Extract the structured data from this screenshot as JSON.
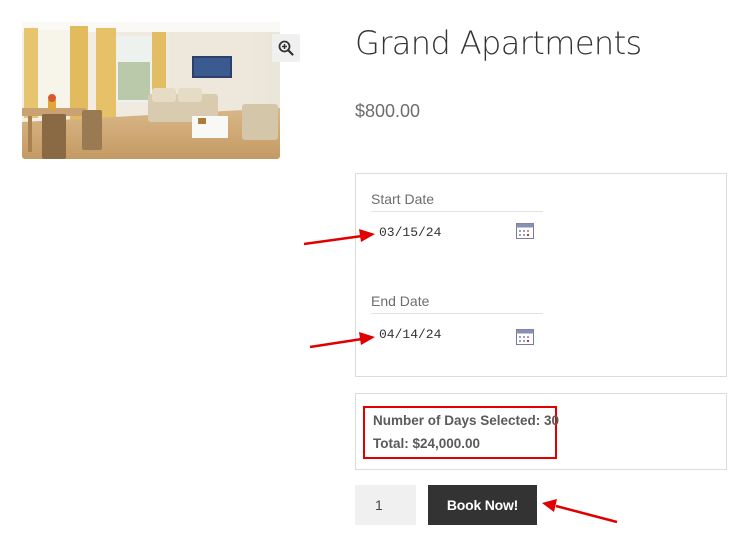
{
  "product": {
    "title": "Grand Apartments",
    "price": "$800.00",
    "image_alt": "apartment-interior-photo",
    "zoom_icon": "zoom-in-icon"
  },
  "booking": {
    "start_label": "Start Date",
    "start_value": "03/15/24",
    "end_label": "End Date",
    "end_value": "04/14/24",
    "calendar_icon": "calendar-icon"
  },
  "summary": {
    "days_text": "Number of Days Selected: 30",
    "total_text": "Total: $24,000.00"
  },
  "purchase": {
    "quantity": "1",
    "book_label": "Book Now!"
  },
  "colors": {
    "annotation_red": "#e00000",
    "button_bg": "#333333",
    "border": "#dcdcdc"
  }
}
